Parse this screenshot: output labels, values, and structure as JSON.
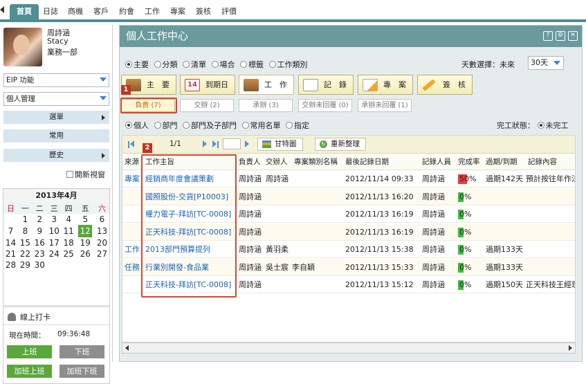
{
  "topnav": {
    "tabs": [
      "首頁",
      "日誌",
      "商機",
      "客戶",
      "約會",
      "工作",
      "專案",
      "簽核",
      "評價"
    ],
    "active_index": 0
  },
  "user": {
    "name_cn": "周詩涵",
    "name_en": "Stacy",
    "dept": "業務一部"
  },
  "left_menu": {
    "module_select": "EIP 功能",
    "submodule_select": "個人管理",
    "menu_items": [
      "選單",
      "常用",
      "歷史"
    ],
    "open_window_label": "開新視窗"
  },
  "calendar": {
    "title": "2013年4月",
    "weekdays": [
      "日",
      "一",
      "二",
      "三",
      "四",
      "五",
      "六"
    ],
    "weeks": [
      [
        "",
        "1",
        "2",
        "3",
        "4",
        "5",
        "6"
      ],
      [
        "7",
        "8",
        "9",
        "10",
        "11",
        "12",
        "13"
      ],
      [
        "14",
        "15",
        "16",
        "17",
        "18",
        "19",
        "20"
      ],
      [
        "21",
        "22",
        "23",
        "24",
        "25",
        "26",
        "27"
      ],
      [
        "28",
        "29",
        "30",
        "",
        "",
        "",
        ""
      ]
    ],
    "today": "12"
  },
  "clock": {
    "title": "線上打卡",
    "time_label": "現在時間：",
    "time_value": "09:36:48",
    "btn_on": "上班",
    "btn_off": "下班",
    "btn_ot_on": "加班上班",
    "btn_ot_off": "加班下班"
  },
  "main": {
    "title": "個人工作中心",
    "header_icons": [
      "help-icon",
      "settings-icon",
      "close-icon"
    ],
    "filter_radios": [
      "主要",
      "分類",
      "清單",
      "場合",
      "標籤",
      "工作類別"
    ],
    "days_label": "天數選擇：未來",
    "days_value": "30天",
    "big_buttons": [
      "主　要",
      "到期日",
      "工　作",
      "記　錄",
      "專　案",
      "簽　核"
    ],
    "date_icon_num": "14",
    "sub_tabs": [
      "負責 (7)",
      "交辦 (2)",
      "承辦 (3)",
      "交辦未回覆 (0)",
      "承辦未回覆 (1)"
    ],
    "scope_radios": [
      "個人",
      "部門",
      "部門及子部門",
      "常用名單",
      "指定"
    ],
    "status_label": "完工狀態：",
    "status_value": "未完工",
    "pager": "1/1",
    "gantt_btn": "甘特圖",
    "refresh_btn": "重新整理",
    "badge1": "1",
    "badge2": "2"
  },
  "table": {
    "headers": [
      "來源",
      "工作主旨",
      "負責人",
      "交辦人",
      "專案類別名稱",
      "最後記錄日期",
      "記錄人員",
      "完成率",
      "過期/到期",
      "記錄內容"
    ],
    "rows": [
      {
        "source": "專案",
        "subject": "經銷商年度會議策劃",
        "owner": "周詩涵",
        "assigner": "周詩涵",
        "category": "",
        "date": "2012/11/14 09:33",
        "recorder": "周詩涵",
        "pct": "50%",
        "pct_value": 50,
        "due": "過期142天",
        "note": "預計按往年作法"
      },
      {
        "source": "",
        "subject": "國照股份-交貨[P10003]",
        "owner": "周詩涵",
        "assigner": "",
        "category": "",
        "date": "2012/11/13 16:20",
        "recorder": "周詩涵",
        "pct": "0%",
        "pct_value": 0,
        "due": "",
        "note": ""
      },
      {
        "source": "",
        "subject": "權力電子-拜訪[TC-0008]",
        "owner": "周詩涵",
        "assigner": "",
        "category": "",
        "date": "2012/11/13 16:19",
        "recorder": "周詩涵",
        "pct": "0%",
        "pct_value": 0,
        "due": "",
        "note": ""
      },
      {
        "source": "",
        "subject": "正天科技-拜訪[TC-0008]",
        "owner": "周詩涵",
        "assigner": "",
        "category": "",
        "date": "2012/11/13 16:19",
        "recorder": "周詩涵",
        "pct": "0%",
        "pct_value": 0,
        "due": "",
        "note": ""
      },
      {
        "source": "工作",
        "subject": "2013部門預算提列",
        "owner": "周詩涵",
        "assigner": "黃羽柔",
        "category": "",
        "date": "2012/11/13 15:38",
        "recorder": "周詩涵",
        "pct": "0%",
        "pct_value": 0,
        "due": "過期133天",
        "note": ""
      },
      {
        "source": "任務",
        "subject": "行業別開發-食品業",
        "owner": "周詩涵",
        "assigner": "吳士宸",
        "category": "李自穎",
        "date": "2012/11/13 15:33",
        "recorder": "周詩涵",
        "pct": "0%",
        "pct_value": 0,
        "due": "過期133天",
        "note": ""
      },
      {
        "source": "",
        "subject": "正天科技-拜訪[TC-0008]",
        "owner": "周詩涵",
        "assigner": "",
        "category": "",
        "date": "2012/11/13 15:12",
        "recorder": "周詩涵",
        "pct": "0%",
        "pct_value": 0,
        "due": "過期150天",
        "note": "正天科技王經理"
      }
    ]
  },
  "colors": {
    "accent": "#4f8e93",
    "link": "#1c64b8",
    "highlight": "#d8462e",
    "progress_red": "#e63c3c",
    "progress_green": "#3cbd3c"
  }
}
